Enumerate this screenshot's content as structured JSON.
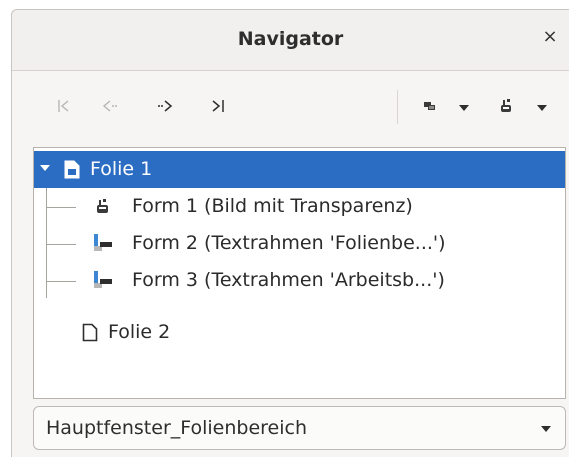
{
  "window": {
    "title": "Navigator",
    "close_glyph": "×"
  },
  "toolbar": {
    "buttons": [
      {
        "name": "first-slide",
        "glyph": "|<",
        "enabled": false
      },
      {
        "name": "previous-slide",
        "glyph": "<·",
        "enabled": false
      },
      {
        "name": "next-slide",
        "glyph": "·>",
        "enabled": true
      },
      {
        "name": "last-slide",
        "glyph": ">|",
        "enabled": true
      }
    ],
    "menus": [
      {
        "name": "drag-mode",
        "icon": "drag-mode-icon"
      },
      {
        "name": "shapes",
        "icon": "shapes-icon"
      }
    ]
  },
  "tree": {
    "items": [
      {
        "label": "Folie 1",
        "level": 0,
        "selected": true,
        "expanded": true,
        "icon": "slide-icon"
      },
      {
        "label": "Form 1 (Bild mit Transparenz)",
        "level": 1,
        "icon": "image-shape-icon"
      },
      {
        "label": "Form 2 (Textrahmen 'Folienbe...')",
        "level": 1,
        "icon": "text-frame-icon"
      },
      {
        "label": "Form 3 (Textrahmen 'Arbeitsb...')",
        "level": 1,
        "icon": "text-frame-icon"
      },
      {
        "label": "Folie 2",
        "level": 0,
        "selected": false,
        "icon": "slide-icon"
      }
    ]
  },
  "document_select": {
    "value": "Hauptfenster_Folienbereich"
  },
  "colors": {
    "selection": "#2c6dc4",
    "accent_icon": "#3d86d4"
  }
}
